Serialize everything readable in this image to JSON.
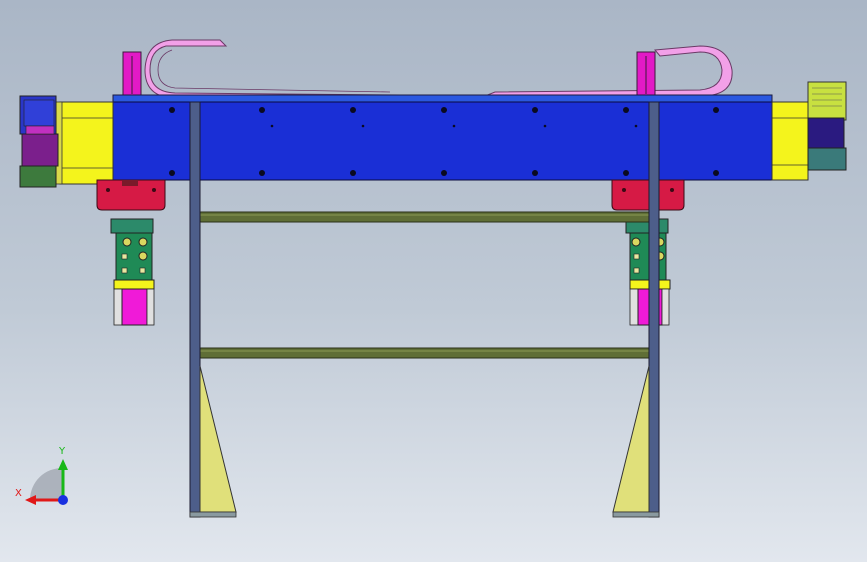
{
  "view": {
    "background_top": "#aab6c6",
    "background_bottom": "#e2e7ee"
  },
  "triad": {
    "x_label": "X",
    "y_label": "Y",
    "x_color": "#e01818",
    "y_color": "#18b818",
    "z_color": "#1830e0"
  },
  "colors": {
    "beam": "#1a2fd6",
    "beam_top_plate": "#2a58e0",
    "end_plate_yellow": "#f4f41c",
    "motor_purple": "#7b1f8c",
    "motor_green": "#3d7a3d",
    "bracket_red": "#d61a45",
    "slide_block": "#1f8a56",
    "slide_magenta": "#f01ad8",
    "cable_chain": "#f2a0e8",
    "frame": "#4d5e8a",
    "tube": "#5f6e36",
    "gusset": "#e0e07a"
  }
}
